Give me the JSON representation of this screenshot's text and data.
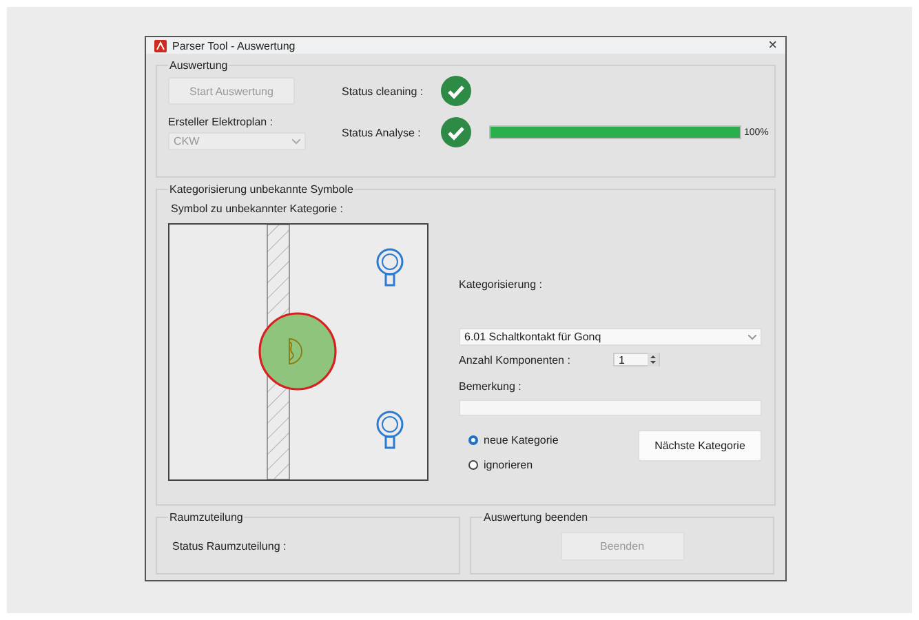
{
  "window": {
    "title": "Parser Tool - Auswertung",
    "close": "×"
  },
  "auswertung": {
    "title": "Auswertung",
    "start_button": {
      "label": "Start Auswertung",
      "disabled": true
    },
    "ersteller_label": "Ersteller Elektroplan :",
    "ersteller": {
      "value": "CKW",
      "disabled": true
    },
    "status": [
      {
        "label": "Status cleaning :",
        "done": true
      },
      {
        "label": "Status Analyse :",
        "done": true,
        "level": 1,
        "reading": "100%"
      }
    ]
  },
  "kategorisierung": {
    "title": "Kategorisierung unbekannte Symbole",
    "symbol_label": "Symbol zu unbekannter Kategorie :",
    "kategorie_label": "Kategorisierung :",
    "kategorie": "6.01 Schaltkontakt für Gonq",
    "anzahl_label": "Anzahl Komponenten :",
    "anzahl": "1",
    "bemerkung_label": "Bemerkung :",
    "options": [
      {
        "label": "neue Kategorie",
        "selected": true
      },
      {
        "label": "ignorieren",
        "selected": false
      }
    ],
    "next_button": "Nächste Kategorie"
  },
  "raumzuteilung": {
    "title": "Raumzuteilung",
    "status_label": "Status Raumzuteilung :"
  },
  "beenden": {
    "title": "Auswertung beenden",
    "button": {
      "label": "Beenden",
      "disabled": true
    }
  }
}
